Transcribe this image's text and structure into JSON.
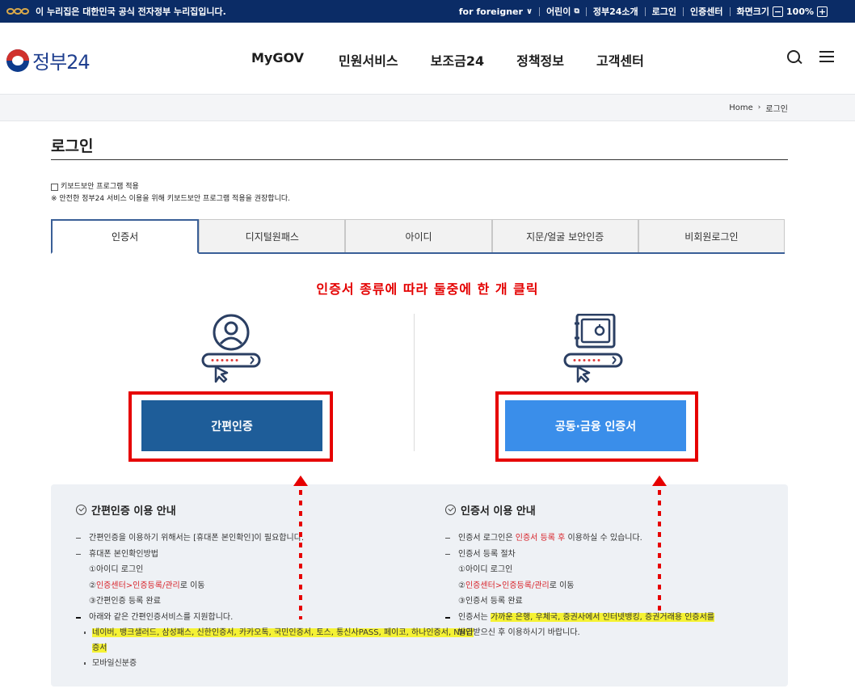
{
  "topbar": {
    "official_notice": "이 누리집은 대한민국 공식 전자정부 누리집입니다.",
    "links": [
      "for foreigner",
      "어린이",
      "정부24소개",
      "로그인",
      "인증센터"
    ],
    "zoom_label": "화면크기",
    "zoom_minus": "−",
    "zoom_value": "100%",
    "zoom_plus": "+"
  },
  "header": {
    "logo_text": "정부24",
    "nav": [
      "MyGOV",
      "민원서비스",
      "보조금24",
      "정책정보",
      "고객센터"
    ]
  },
  "breadcrumb": {
    "home": "Home",
    "current": "로그인"
  },
  "page": {
    "title": "로그인",
    "keyboard_label": "키보드보안 프로그램 적용",
    "keyboard_note": "※ 안전한 정부24 서비스 이용을 위해 키보드보안 프로그램 적용을 권장합니다."
  },
  "tabs": [
    "인증서",
    "디지털원패스",
    "아이디",
    "지문/얼굴 보안인증",
    "비회원로그인"
  ],
  "notice": "인증서 종류에 따라 둘중에 한 개 클릭",
  "buttons": {
    "simple": "간편인증",
    "cert": "공동·금융 인증서"
  },
  "info_left": {
    "title": "간편인증 이용 안내",
    "line1": "간편인증을 이용하기 위해서는 [휴대폰 본인확인]이 필요합니다.",
    "line2": "휴대폰 본인확인방법",
    "step1": "①아이디 로그인",
    "step2_num": "②",
    "step2_link": "인증센터>인증등록/관리",
    "step2_suffix": "로 이동",
    "step3": "③간편인증 등록 완료",
    "line3": "아래와 같은 간편인증서비스를 지원합니다.",
    "providers_1": "네이버, 뱅크샐러드, 삼성패스, 신한인증서, 카카오톡, 국민인증서, 토스, 통신사PASS, 페이코, 하나인증서, NH인",
    "providers_2": "증서",
    "mobile_id": "모바일신분증"
  },
  "info_right": {
    "title": "인증서 이용 안내",
    "line1_pre": "인증서 로그인은 ",
    "line1_link": "인증서 등록 후",
    "line1_post": " 이용하실 수 있습니다.",
    "line2": "인증서 등록 절차",
    "step1": "①아이디 로그인",
    "step2_num": "②",
    "step2_link": "인증센터>인증등록/관리",
    "step2_suffix": "로 이동",
    "step3": "③인증서 등록 완료",
    "line3_pre": "인증서는 ",
    "line3_hl": "가까운 은행, 우체국, 증권사에서 인터넷뱅킹, 증권거래용 인증서를",
    "line3_post": "발급받으신 후 이용하시기 바랍니다."
  },
  "colors": {
    "navy": "#0b2c66",
    "simple_button": "#1e5d99",
    "cert_button": "#3a8eea",
    "annotation_red": "#e60000",
    "highlight": "#f5f233"
  }
}
